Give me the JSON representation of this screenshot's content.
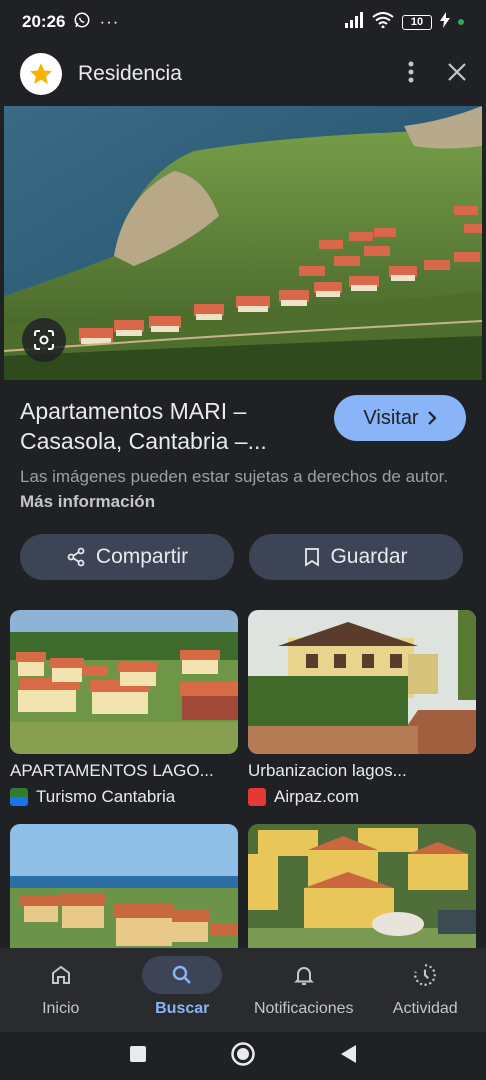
{
  "status_bar": {
    "time": "20:26",
    "battery": "10"
  },
  "header": {
    "title": "Residencia"
  },
  "result": {
    "title": "Apartamentos MARI – Casasola, Cantabria –...",
    "visit_label": "Visitar",
    "copyright_text": "Las imágenes pueden estar sujetas a derechos de autor.",
    "more_info": "Más información"
  },
  "actions": {
    "share_label": "Compartir",
    "save_label": "Guardar"
  },
  "related": [
    {
      "title": "APARTAMENTOS LAGO...",
      "source": "Turismo Cantabria",
      "source_color": "#1a73e8"
    },
    {
      "title": "Urbanizacion lagos...",
      "source": "Airpaz.com",
      "source_color": "#e53935"
    }
  ],
  "bottom_nav": [
    {
      "label": "Inicio",
      "icon": "home-icon",
      "active": false
    },
    {
      "label": "Buscar",
      "icon": "search-icon",
      "active": true
    },
    {
      "label": "Notificaciones",
      "icon": "bell-icon",
      "active": false
    },
    {
      "label": "Actividad",
      "icon": "activity-icon",
      "active": false
    }
  ],
  "colors": {
    "accent": "#8ab4f8",
    "background": "#202124",
    "chip": "#3c4455"
  }
}
